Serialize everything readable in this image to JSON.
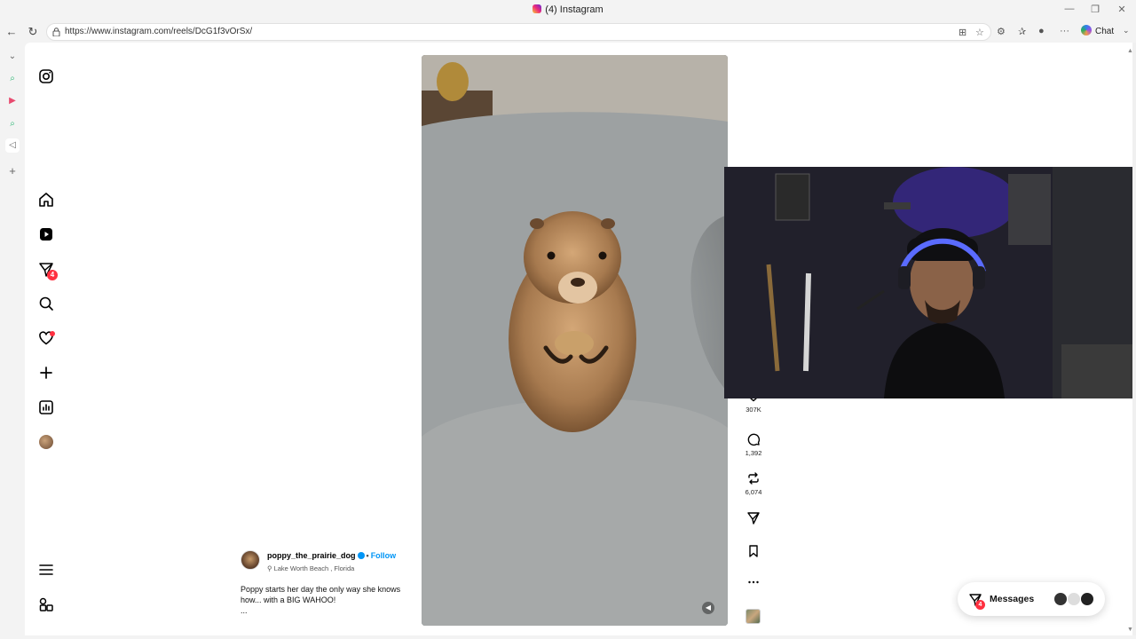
{
  "window": {
    "title": "(4) Instagram"
  },
  "browser": {
    "url": "https://www.instagram.com/reels/DcG1f3vOrSx/",
    "chat_label": "Chat"
  },
  "instagram": {
    "sidebar": {
      "items": [
        "Instagram",
        "Home",
        "Reels",
        "Messages",
        "Search",
        "Notifications",
        "Create",
        "Dashboard",
        "Profile",
        "More",
        "Also from Meta"
      ],
      "messages_badge": "4"
    },
    "reel": {
      "author": "poppy_the_prairie_dog",
      "separator": "•",
      "follow_label": "Follow",
      "location": "Lake Worth Beach , Florida",
      "caption": "Poppy starts her day the only way she knows how... with a BIG WAHOO!",
      "caption_more": "...",
      "likes": "307K",
      "comments": "1,392",
      "reposts": "6,074"
    },
    "messages_dock": {
      "label": "Messages",
      "badge": "4"
    }
  },
  "colors": {
    "accent": "#0095f6",
    "badge": "#ff3040"
  }
}
